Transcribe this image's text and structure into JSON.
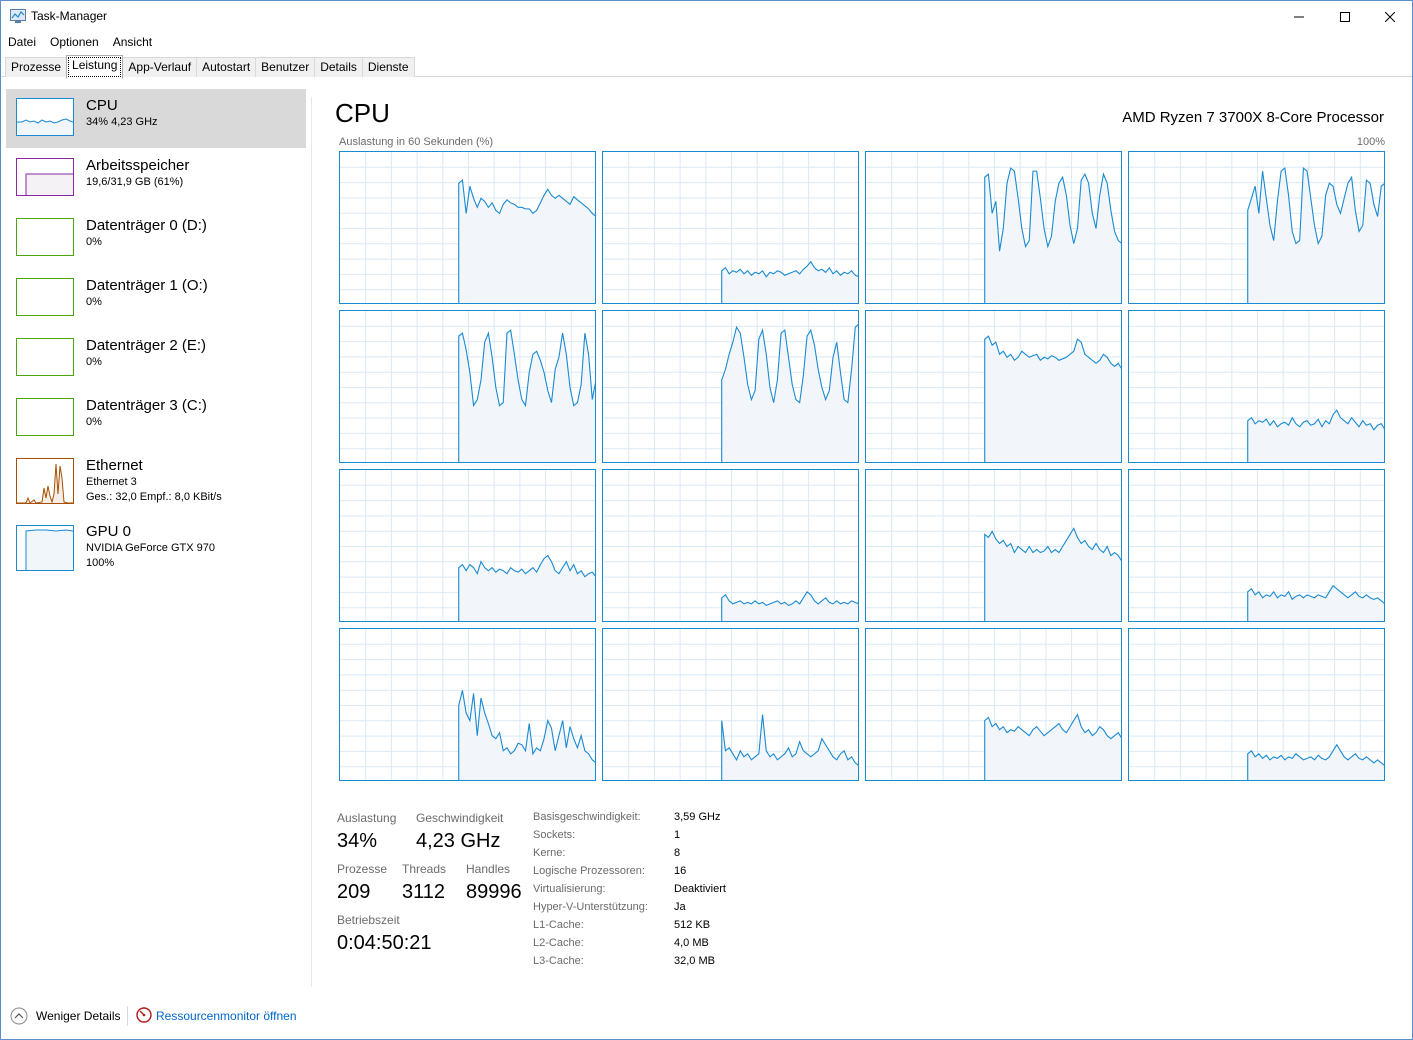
{
  "window": {
    "title": "Task-Manager",
    "minimize_icon": "minimize-icon",
    "maximize_icon": "maximize-icon",
    "close_icon": "close-icon"
  },
  "menu": [
    "Datei",
    "Optionen",
    "Ansicht"
  ],
  "tabs": [
    "Prozesse",
    "Leistung",
    "App-Verlauf",
    "Autostart",
    "Benutzer",
    "Details",
    "Dienste"
  ],
  "active_tab": "Leistung",
  "sidebar": {
    "items": [
      {
        "title": "CPU",
        "lines": [
          "34% 4,23 GHz"
        ],
        "color": "#1a8ad2",
        "active": true
      },
      {
        "title": "Arbeitsspeicher",
        "lines": [
          "19,6/31,9 GB (61%)"
        ],
        "color": "#8b26a7"
      },
      {
        "title": "Datenträger 0 (D:)",
        "lines": [
          "0%"
        ],
        "color": "#4da60c"
      },
      {
        "title": "Datenträger 1 (O:)",
        "lines": [
          "0%"
        ],
        "color": "#4da60c"
      },
      {
        "title": "Datenträger 2 (E:)",
        "lines": [
          "0%"
        ],
        "color": "#4da60c"
      },
      {
        "title": "Datenträger 3 (C:)",
        "lines": [
          "0%"
        ],
        "color": "#4da60c"
      },
      {
        "title": "Ethernet",
        "lines": [
          "Ethernet 3",
          "Ges.: 32,0  Empf.: 8,0 KBit/s"
        ],
        "color": "#a74f01"
      },
      {
        "title": "GPU 0",
        "lines": [
          "NVIDIA GeForce GTX 970",
          "100%"
        ],
        "color": "#1a8ad2"
      }
    ]
  },
  "main": {
    "title": "CPU",
    "model": "AMD Ryzen 7 3700X 8-Core Processor",
    "graph_caption": "Auslastung in 60 Sekunden (%)",
    "graph_max": "100%",
    "graph_color": "#1a8ad2",
    "cores": [
      {
        "level": "high-flat",
        "values": [
          0,
          0,
          0,
          0,
          0,
          0,
          0,
          0,
          0,
          0,
          0,
          0,
          0,
          0,
          0,
          0,
          0,
          0,
          0,
          0,
          0,
          0,
          0,
          0,
          0,
          0,
          0,
          0,
          0,
          0,
          0,
          0,
          80,
          82,
          60,
          78,
          70,
          64,
          70,
          68,
          64,
          67,
          62,
          60,
          66,
          69,
          67,
          66,
          64,
          64,
          63,
          63,
          60,
          62,
          67,
          72,
          76,
          72,
          70,
          72,
          70,
          68,
          66,
          71,
          69,
          67,
          65,
          63,
          60,
          58
        ]
      },
      {
        "level": "low",
        "values": [
          0,
          0,
          0,
          0,
          0,
          0,
          0,
          0,
          0,
          0,
          0,
          0,
          0,
          0,
          0,
          0,
          0,
          0,
          0,
          0,
          0,
          0,
          0,
          0,
          0,
          0,
          0,
          0,
          0,
          0,
          0,
          0,
          22,
          24,
          20,
          22,
          21,
          23,
          20,
          22,
          19,
          21,
          20,
          22,
          18,
          21,
          20,
          22,
          21,
          19,
          20,
          21,
          22,
          20,
          23,
          25,
          28,
          24,
          22,
          23,
          21,
          24,
          20,
          22,
          19,
          21,
          20,
          22,
          19,
          18
        ]
      },
      {
        "level": "spiky",
        "values": [
          0,
          0,
          0,
          0,
          0,
          0,
          0,
          0,
          0,
          0,
          0,
          0,
          0,
          0,
          0,
          0,
          0,
          0,
          0,
          0,
          0,
          0,
          0,
          0,
          0,
          0,
          0,
          0,
          0,
          0,
          0,
          0,
          84,
          86,
          60,
          68,
          35,
          50,
          80,
          90,
          88,
          70,
          50,
          38,
          42,
          88,
          88,
          70,
          50,
          38,
          45,
          68,
          80,
          84,
          72,
          52,
          40,
          50,
          82,
          86,
          80,
          60,
          50,
          72,
          86,
          80,
          62,
          48,
          42,
          40
        ]
      },
      {
        "level": "spiky",
        "values": [
          0,
          0,
          0,
          0,
          0,
          0,
          0,
          0,
          0,
          0,
          0,
          0,
          0,
          0,
          0,
          0,
          0,
          0,
          0,
          0,
          0,
          0,
          0,
          0,
          0,
          0,
          0,
          0,
          0,
          0,
          0,
          0,
          62,
          70,
          78,
          60,
          88,
          70,
          52,
          42,
          68,
          88,
          90,
          72,
          48,
          40,
          42,
          90,
          88,
          70,
          52,
          40,
          45,
          72,
          80,
          78,
          66,
          60,
          70,
          80,
          84,
          62,
          48,
          52,
          82,
          80,
          66,
          58,
          78,
          80
        ]
      },
      {
        "level": "spiky",
        "values": [
          0,
          0,
          0,
          0,
          0,
          0,
          0,
          0,
          0,
          0,
          0,
          0,
          0,
          0,
          0,
          0,
          0,
          0,
          0,
          0,
          0,
          0,
          0,
          0,
          0,
          0,
          0,
          0,
          0,
          0,
          0,
          0,
          84,
          86,
          75,
          60,
          38,
          42,
          55,
          80,
          86,
          70,
          50,
          38,
          40,
          86,
          88,
          72,
          55,
          42,
          38,
          60,
          72,
          74,
          68,
          60,
          48,
          40,
          62,
          70,
          86,
          72,
          50,
          38,
          40,
          52,
          86,
          72,
          42,
          55
        ]
      },
      {
        "level": "spiky",
        "values": [
          0,
          0,
          0,
          0,
          0,
          0,
          0,
          0,
          0,
          0,
          0,
          0,
          0,
          0,
          0,
          0,
          0,
          0,
          0,
          0,
          0,
          0,
          0,
          0,
          0,
          0,
          0,
          0,
          0,
          0,
          0,
          0,
          55,
          62,
          72,
          80,
          90,
          86,
          70,
          52,
          42,
          48,
          82,
          88,
          72,
          50,
          40,
          55,
          86,
          88,
          70,
          52,
          42,
          40,
          58,
          84,
          88,
          78,
          62,
          50,
          42,
          48,
          70,
          80,
          60,
          42,
          40,
          62,
          90,
          92
        ]
      },
      {
        "level": "high-flat",
        "values": [
          0,
          0,
          0,
          0,
          0,
          0,
          0,
          0,
          0,
          0,
          0,
          0,
          0,
          0,
          0,
          0,
          0,
          0,
          0,
          0,
          0,
          0,
          0,
          0,
          0,
          0,
          0,
          0,
          0,
          0,
          0,
          0,
          82,
          84,
          78,
          80,
          72,
          74,
          70,
          72,
          68,
          70,
          74,
          72,
          70,
          71,
          72,
          68,
          70,
          69,
          71,
          70,
          68,
          69,
          70,
          72,
          74,
          82,
          80,
          72,
          70,
          68,
          66,
          68,
          72,
          70,
          66,
          64,
          66,
          62
        ]
      },
      {
        "level": "low",
        "values": [
          0,
          0,
          0,
          0,
          0,
          0,
          0,
          0,
          0,
          0,
          0,
          0,
          0,
          0,
          0,
          0,
          0,
          0,
          0,
          0,
          0,
          0,
          0,
          0,
          0,
          0,
          0,
          0,
          0,
          0,
          0,
          0,
          28,
          30,
          26,
          28,
          27,
          29,
          25,
          28,
          24,
          26,
          27,
          25,
          30,
          26,
          24,
          27,
          28,
          25,
          26,
          29,
          24,
          28,
          26,
          32,
          35,
          30,
          28,
          26,
          30,
          27,
          24,
          28,
          25,
          26,
          22,
          25,
          26,
          22
        ]
      },
      {
        "level": "low-mid",
        "values": [
          0,
          0,
          0,
          0,
          0,
          0,
          0,
          0,
          0,
          0,
          0,
          0,
          0,
          0,
          0,
          0,
          0,
          0,
          0,
          0,
          0,
          0,
          0,
          0,
          0,
          0,
          0,
          0,
          0,
          0,
          0,
          0,
          36,
          38,
          34,
          38,
          36,
          32,
          40,
          36,
          34,
          36,
          33,
          35,
          34,
          32,
          36,
          34,
          33,
          35,
          32,
          34,
          36,
          33,
          38,
          42,
          44,
          40,
          34,
          32,
          36,
          40,
          34,
          38,
          32,
          34,
          30,
          32,
          33,
          30
        ]
      },
      {
        "level": "low",
        "values": [
          0,
          0,
          0,
          0,
          0,
          0,
          0,
          0,
          0,
          0,
          0,
          0,
          0,
          0,
          0,
          0,
          0,
          0,
          0,
          0,
          0,
          0,
          0,
          0,
          0,
          0,
          0,
          0,
          0,
          0,
          0,
          0,
          16,
          18,
          14,
          12,
          13,
          14,
          12,
          13,
          12,
          14,
          12,
          13,
          11,
          12,
          13,
          14,
          12,
          13,
          11,
          12,
          14,
          12,
          16,
          20,
          18,
          14,
          12,
          14,
          16,
          13,
          12,
          14,
          12,
          13,
          12,
          14,
          13,
          12
        ]
      },
      {
        "level": "mid",
        "values": [
          0,
          0,
          0,
          0,
          0,
          0,
          0,
          0,
          0,
          0,
          0,
          0,
          0,
          0,
          0,
          0,
          0,
          0,
          0,
          0,
          0,
          0,
          0,
          0,
          0,
          0,
          0,
          0,
          0,
          0,
          0,
          0,
          58,
          56,
          60,
          55,
          52,
          54,
          50,
          52,
          46,
          50,
          48,
          46,
          50,
          46,
          48,
          46,
          47,
          50,
          46,
          48,
          46,
          50,
          54,
          58,
          62,
          56,
          52,
          54,
          50,
          48,
          52,
          48,
          46,
          50,
          44,
          46,
          44,
          40
        ]
      },
      {
        "level": "low",
        "values": [
          0,
          0,
          0,
          0,
          0,
          0,
          0,
          0,
          0,
          0,
          0,
          0,
          0,
          0,
          0,
          0,
          0,
          0,
          0,
          0,
          0,
          0,
          0,
          0,
          0,
          0,
          0,
          0,
          0,
          0,
          0,
          0,
          20,
          22,
          18,
          20,
          16,
          18,
          17,
          20,
          16,
          18,
          17,
          20,
          15,
          17,
          18,
          16,
          18,
          17,
          16,
          18,
          17,
          16,
          20,
          24,
          22,
          20,
          18,
          16,
          18,
          20,
          17,
          16,
          18,
          16,
          15,
          16,
          14,
          12
        ]
      },
      {
        "level": "spiky-mid",
        "values": [
          0,
          0,
          0,
          0,
          0,
          0,
          0,
          0,
          0,
          0,
          0,
          0,
          0,
          0,
          0,
          0,
          0,
          0,
          0,
          0,
          0,
          0,
          0,
          0,
          0,
          0,
          0,
          0,
          0,
          0,
          0,
          0,
          50,
          60,
          45,
          40,
          58,
          30,
          55,
          45,
          38,
          30,
          28,
          32,
          20,
          22,
          18,
          20,
          25,
          24,
          20,
          38,
          18,
          22,
          20,
          28,
          40,
          35,
          20,
          30,
          40,
          22,
          36,
          28,
          22,
          30,
          20,
          18,
          14,
          12
        ]
      },
      {
        "level": "low-spiky",
        "values": [
          0,
          0,
          0,
          0,
          0,
          0,
          0,
          0,
          0,
          0,
          0,
          0,
          0,
          0,
          0,
          0,
          0,
          0,
          0,
          0,
          0,
          0,
          0,
          0,
          0,
          0,
          0,
          0,
          0,
          0,
          0,
          0,
          40,
          20,
          22,
          18,
          14,
          20,
          16,
          18,
          14,
          16,
          18,
          44,
          20,
          16,
          18,
          14,
          16,
          18,
          22,
          16,
          18,
          26,
          20,
          18,
          16,
          18,
          20,
          28,
          24,
          20,
          16,
          14,
          18,
          20,
          14,
          16,
          12,
          10
        ]
      },
      {
        "level": "low-mid",
        "values": [
          0,
          0,
          0,
          0,
          0,
          0,
          0,
          0,
          0,
          0,
          0,
          0,
          0,
          0,
          0,
          0,
          0,
          0,
          0,
          0,
          0,
          0,
          0,
          0,
          0,
          0,
          0,
          0,
          0,
          0,
          0,
          0,
          40,
          42,
          36,
          38,
          34,
          36,
          32,
          34,
          33,
          36,
          34,
          32,
          30,
          34,
          36,
          33,
          30,
          32,
          34,
          36,
          38,
          34,
          32,
          36,
          40,
          44,
          36,
          32,
          34,
          30,
          32,
          36,
          34,
          30,
          28,
          30,
          32,
          28
        ]
      },
      {
        "level": "low",
        "values": [
          0,
          0,
          0,
          0,
          0,
          0,
          0,
          0,
          0,
          0,
          0,
          0,
          0,
          0,
          0,
          0,
          0,
          0,
          0,
          0,
          0,
          0,
          0,
          0,
          0,
          0,
          0,
          0,
          0,
          0,
          0,
          0,
          18,
          20,
          16,
          18,
          15,
          17,
          14,
          16,
          15,
          17,
          14,
          16,
          15,
          18,
          16,
          14,
          15,
          16,
          14,
          17,
          15,
          14,
          16,
          20,
          24,
          20,
          16,
          14,
          16,
          18,
          15,
          14,
          16,
          14,
          12,
          14,
          12,
          10
        ]
      }
    ]
  },
  "stats": {
    "util_label": "Auslastung",
    "util_value": "34%",
    "speed_label": "Geschwindigkeit",
    "speed_value": "4,23 GHz",
    "proc_label": "Prozesse",
    "proc_value": "209",
    "threads_label": "Threads",
    "threads_value": "3112",
    "handles_label": "Handles",
    "handles_value": "89996",
    "uptime_label": "Betriebszeit",
    "uptime_value": "0:04:50:21"
  },
  "details": [
    {
      "label": "Basisgeschwindigkeit:",
      "value": "3,59 GHz"
    },
    {
      "label": "Sockets:",
      "value": "1"
    },
    {
      "label": "Kerne:",
      "value": "8"
    },
    {
      "label": "Logische Prozessoren:",
      "value": "16"
    },
    {
      "label": "Virtualisierung:",
      "value": "Deaktiviert"
    },
    {
      "label": "Hyper-V-Unterstützung:",
      "value": "Ja"
    },
    {
      "label": "L1-Cache:",
      "value": "512 KB"
    },
    {
      "label": "L2-Cache:",
      "value": "4,0 MB"
    },
    {
      "label": "L3-Cache:",
      "value": "32,0 MB"
    }
  ],
  "footer": {
    "fewer_details": "Weniger Details",
    "resource_monitor": "Ressourcenmonitor öffnen",
    "resource_color": "#0066cc"
  }
}
